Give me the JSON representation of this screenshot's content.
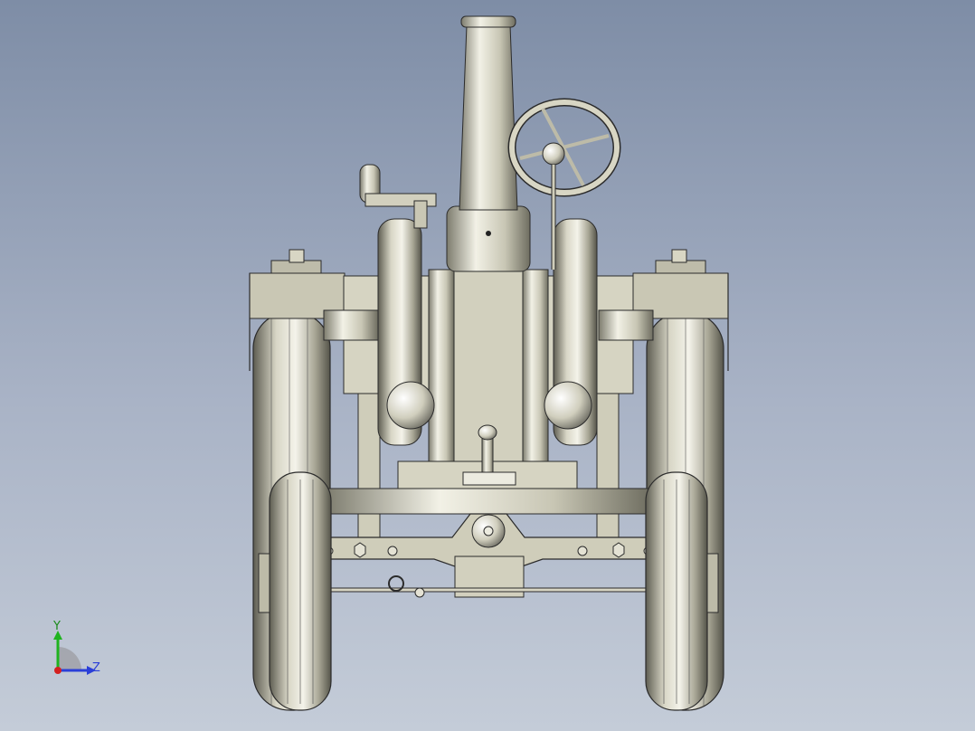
{
  "viewport": {
    "view": "front"
  },
  "model": {
    "name": "tractor-assembly"
  },
  "triad": {
    "y_label": "Y",
    "z_label": "Z",
    "colors": {
      "y": "#1fb31f",
      "z": "#2a3fd8",
      "x": "#d42020"
    }
  },
  "colors": {
    "bg_top": "#7e8da6",
    "bg_bottom": "#c4ccd8",
    "metal": "#d4d2c0",
    "metal_dark": "#9a9888",
    "outline": "#2b2b2b"
  }
}
